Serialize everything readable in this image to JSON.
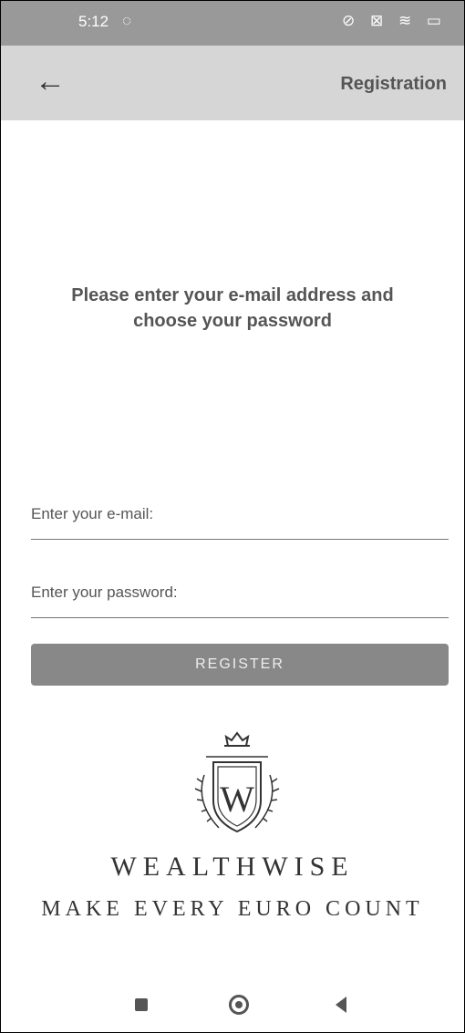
{
  "status_bar": {
    "time": "5:12",
    "sync_icon": "sync-icon",
    "right_icons": "⊘ ⊠ ≋ ▭"
  },
  "app_bar": {
    "back_icon": "←",
    "title": "Registration"
  },
  "instructions": {
    "line1": "Please enter your e-mail address and",
    "line2": "choose your password"
  },
  "email": {
    "label": "Enter your e-mail:"
  },
  "password": {
    "label": "Enter your password:"
  },
  "register_button": {
    "label": "REGISTER"
  },
  "brand": {
    "name": "WEALTHWISE",
    "tagline": "MAKE EVERY EURO COUNT",
    "logo_letter": "W"
  },
  "colors": {
    "status_bar": "#999999",
    "app_bar": "#d6d6d6",
    "button": "#888888"
  }
}
